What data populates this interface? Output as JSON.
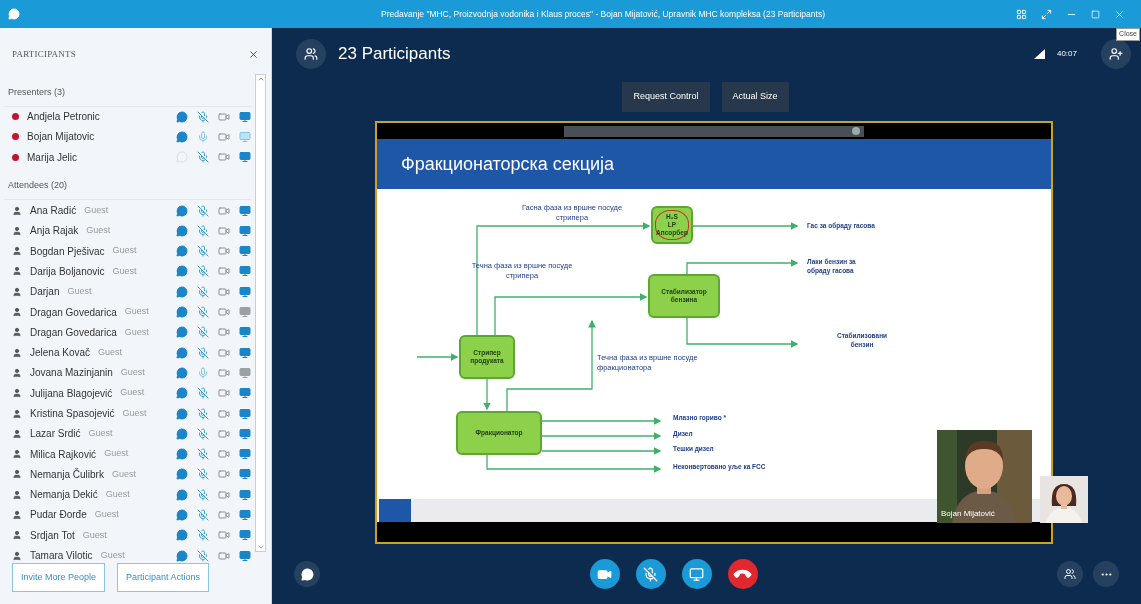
{
  "window": {
    "title": "Predavanje \"MHC, Proizvodnja vodonika i Klaus proces\" - Bojan Mijatović, Upravnik MHC kompleksa (23 Participants)"
  },
  "tooltip": {
    "text": "Close"
  },
  "participants_panel": {
    "title": "PARTICIPANTS",
    "groups": [
      {
        "kind": "presenter",
        "label": "Presenters (3)",
        "members": [
          {
            "name": "Andjela Petronic",
            "chat_available": true,
            "muted": true,
            "screen_available": true,
            "presenting": false
          },
          {
            "name": "Bojan Mijatovic",
            "chat_available": true,
            "muted": false,
            "screen_available": true,
            "presenting": true
          },
          {
            "name": "Marija Jelic",
            "chat_available": false,
            "muted": true,
            "screen_available": true,
            "presenting": false
          }
        ]
      },
      {
        "kind": "attendee",
        "label": "Attendees (20)",
        "members": [
          {
            "name": "Ana Radić",
            "role": "Guest",
            "chat_available": true,
            "muted": true,
            "screen_available": true
          },
          {
            "name": "Anja Rajak",
            "role": "Guest",
            "chat_available": true,
            "muted": true,
            "screen_available": true
          },
          {
            "name": "Bogdan Pješivac",
            "role": "Guest",
            "chat_available": true,
            "muted": true,
            "screen_available": true
          },
          {
            "name": "Darija Boljanovic",
            "role": "Guest",
            "chat_available": true,
            "muted": true,
            "screen_available": true
          },
          {
            "name": "Darjan",
            "role": "Guest",
            "chat_available": true,
            "muted": true,
            "screen_available": true
          },
          {
            "name": "Dragan Govedarica",
            "role": "Guest",
            "chat_available": true,
            "muted": true,
            "screen_available": false
          },
          {
            "name": "Dragan Govedarica",
            "role": "Guest",
            "chat_available": true,
            "muted": true,
            "screen_available": true
          },
          {
            "name": "Jelena Kovač",
            "role": "Guest",
            "chat_available": true,
            "muted": true,
            "screen_available": true
          },
          {
            "name": "Jovana Mazinjanin",
            "role": "Guest",
            "chat_available": true,
            "muted": false,
            "screen_available": false
          },
          {
            "name": "Julijana Blagojević",
            "role": "Guest",
            "chat_available": true,
            "muted": true,
            "screen_available": true
          },
          {
            "name": "Kristina Spasojević",
            "role": "Guest",
            "chat_available": true,
            "muted": true,
            "screen_available": true
          },
          {
            "name": "Lazar Srdić",
            "role": "Guest",
            "chat_available": true,
            "muted": true,
            "screen_available": true
          },
          {
            "name": "Milica Rajković",
            "role": "Guest",
            "chat_available": true,
            "muted": true,
            "screen_available": true
          },
          {
            "name": "Nemanja Čulibrk",
            "role": "Guest",
            "chat_available": true,
            "muted": true,
            "screen_available": true
          },
          {
            "name": "Nemanja Dekić",
            "role": "Guest",
            "chat_available": true,
            "muted": true,
            "screen_available": true
          },
          {
            "name": "Pudar Đorđe",
            "role": "Guest",
            "chat_available": true,
            "muted": true,
            "screen_available": true
          },
          {
            "name": "Srdjan Tot",
            "role": "Guest",
            "chat_available": true,
            "muted": true,
            "screen_available": true
          },
          {
            "name": "Tamara Vilotic",
            "role": "Guest",
            "chat_available": true,
            "muted": true,
            "screen_available": true
          }
        ]
      }
    ],
    "buttons": [
      "Invite More People",
      "Participant Actions"
    ]
  },
  "stage": {
    "participant_count": "23 Participants",
    "timer": "40:07",
    "buttons": [
      "Request Control",
      "Actual Size"
    ],
    "slide": {
      "title": "Фракционаторска секција",
      "boxes": [
        {
          "kind": "absorber",
          "lines": [
            "H₂S",
            "LP",
            "Апсорбер"
          ],
          "circled": true
        },
        {
          "kind": "stabilizer",
          "lines": [
            "Стабилизатор",
            "бензина"
          ],
          "circled": false
        },
        {
          "kind": "stripper",
          "lines": [
            "Стрипер",
            "продуката"
          ],
          "circled": false
        },
        {
          "kind": "fractionator",
          "lines": [
            "Фракционатор"
          ],
          "circled": false
        }
      ],
      "flow_labels": [
        {
          "kind": "gas_phase",
          "text": "Гасна фаза из вршне посуде стрипера"
        },
        {
          "kind": "liquid_stripper",
          "text": "Течна фаза из вршне посуде стрипера"
        },
        {
          "kind": "liquid_fractionator",
          "text": "Течна фаза из вршне посуде фракционатора"
        }
      ],
      "products": [
        {
          "kind": "gas",
          "text": "Гас за обраду гасова"
        },
        {
          "kind": "naphtha",
          "text": "Лаки бензин за обраду гасова"
        },
        {
          "kind": "stable",
          "text": "Стабилизовани бензин"
        },
        {
          "kind": "jet",
          "text": "Млазно гориво *"
        },
        {
          "kind": "diesel",
          "text": "Дизел"
        },
        {
          "kind": "heavy",
          "text": "Тешки дизел"
        },
        {
          "kind": "unconverted",
          "text": "Неконвертовано уље ка FCC"
        }
      ]
    },
    "video_tiles": [
      {
        "kind": "picture",
        "caption": "Bojan Mijatović"
      },
      {
        "kind": "picture"
      }
    ],
    "mic_muted": true
  }
}
